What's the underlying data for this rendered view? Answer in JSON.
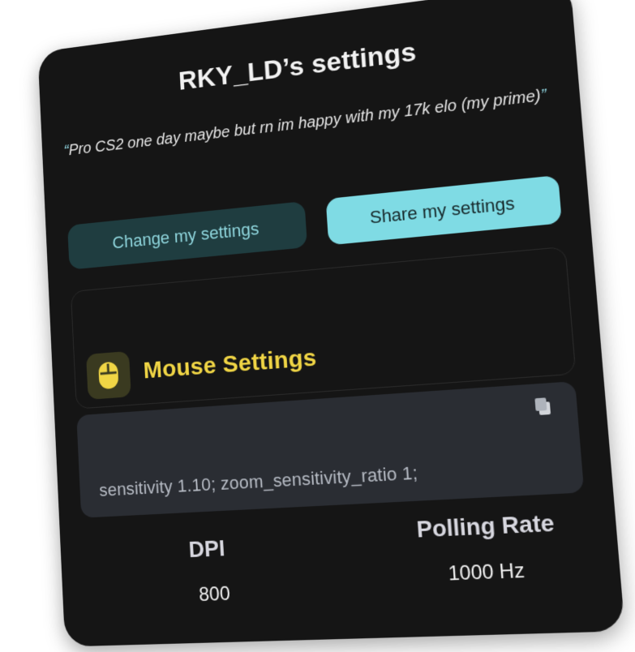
{
  "card": {
    "title": "RKY_LD’s settings",
    "quote_open": "“",
    "quote_text": "Pro CS2  one day maybe but rn im happy with my 17k elo (my prime)",
    "quote_close": "”"
  },
  "buttons": {
    "change_label": "Change my settings",
    "share_label": "Share my settings"
  },
  "mouse": {
    "section_title": "Mouse Settings",
    "icon": "mouse-icon",
    "config_text": "sensitivity 1.10; zoom_sensitivity_ratio 1;",
    "copy_icon": "copy-icon",
    "dpi_label": "DPI",
    "dpi_value": "800",
    "polling_label": "Polling Rate",
    "polling_value": "1000 Hz"
  },
  "colors": {
    "card_bg": "#151515",
    "accent_yellow": "#f0d545",
    "accent_cyan": "#7fdbe4",
    "button_dark": "#1f3d40",
    "config_bg": "#2a2d33"
  }
}
